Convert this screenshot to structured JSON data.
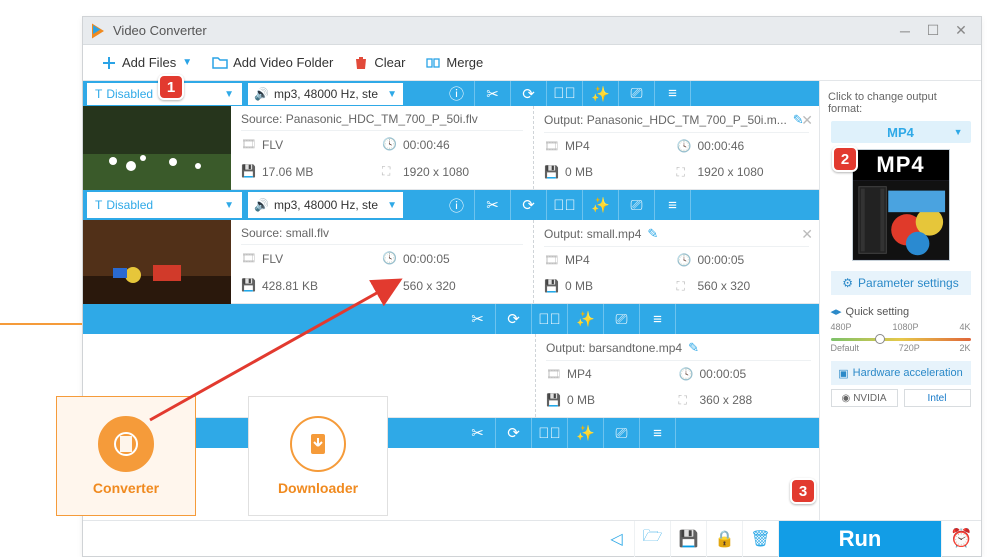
{
  "window": {
    "title": "Video Converter"
  },
  "toolbar": {
    "add_files": "Add Files",
    "add_folder": "Add Video Folder",
    "clear": "Clear",
    "merge": "Merge"
  },
  "audio_select": {
    "label": "Disabled",
    "format": "mp3, 48000 Hz, ste"
  },
  "files": [
    {
      "source_label": "Source: Panasonic_HDC_TM_700_P_50i.flv",
      "src_format": "FLV",
      "src_duration": "00:00:46",
      "src_size": "17.06 MB",
      "src_res": "1920 x 1080",
      "output_label": "Output: Panasonic_HDC_TM_700_P_50i.m...",
      "out_format": "MP4",
      "out_duration": "00:00:46",
      "out_size": "0 MB",
      "out_res": "1920 x 1080"
    },
    {
      "source_label": "Source: small.flv",
      "src_format": "FLV",
      "src_duration": "00:00:05",
      "src_size": "428.81 KB",
      "src_res": "560 x 320",
      "output_label": "Output: small.mp4",
      "out_format": "MP4",
      "out_duration": "00:00:05",
      "out_size": "0 MB",
      "out_res": "560 x 320"
    },
    {
      "output_label": "Output: barsandtone.mp4",
      "out_format": "MP4",
      "out_duration": "00:00:05",
      "out_size": "0 MB",
      "out_res": "360 x 288"
    }
  ],
  "output_panel": {
    "header": "Click to change output format:",
    "format": "MP4",
    "mp4_label": "MP4",
    "parameter_btn": "Parameter settings",
    "quick_setting": "Quick setting",
    "hw_accel": "Hardware acceleration",
    "nvidia": "NVIDIA",
    "intel": "Intel",
    "resolutions": {
      "a": "480P",
      "b": "1080P",
      "c": "4K",
      "d": "Default",
      "e": "720P",
      "f": "2K"
    }
  },
  "footer": {
    "run": "Run"
  },
  "tiles": {
    "converter": "Converter",
    "downloader": "Downloader"
  },
  "badges": {
    "one": "1",
    "two": "2",
    "three": "3"
  }
}
